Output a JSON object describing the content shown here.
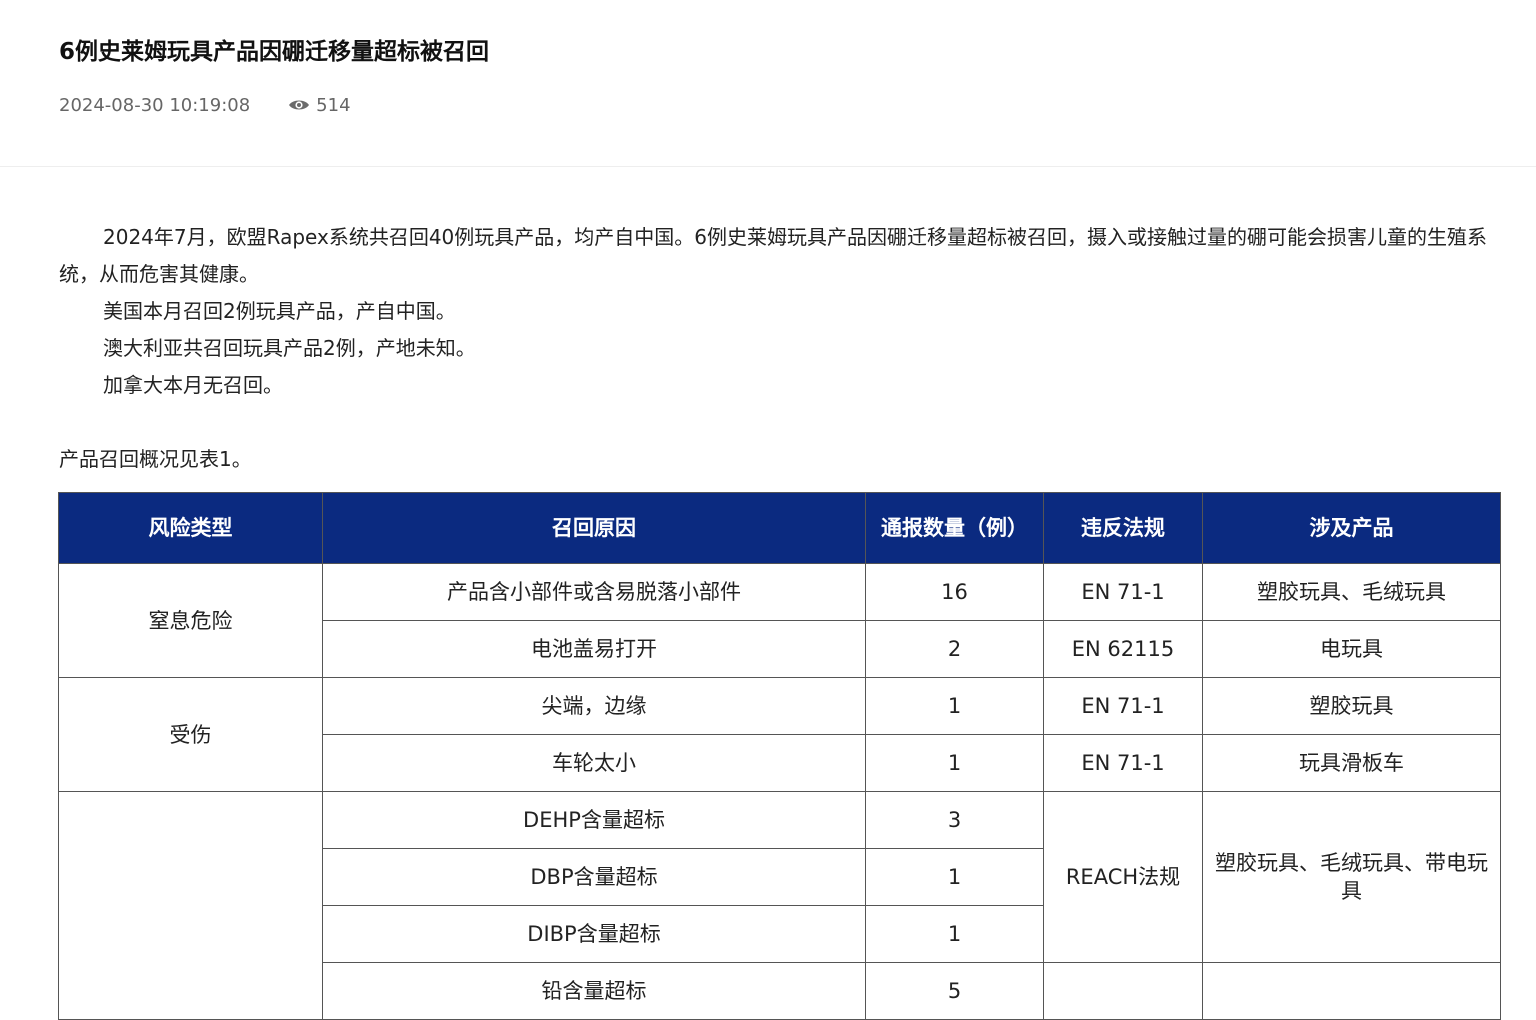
{
  "article": {
    "title": "6例史莱姆玩具产品因硼迁移量超标被召回",
    "date": "2024-08-30 10:19:08",
    "views": "514",
    "paragraphs": [
      "2024年7月，欧盟Rapex系统共召回40例玩具产品，均产自中国。6例史莱姆玩具产品因硼迁移量超标被召回，摄入或接触过量的硼可能会损害儿童的生殖系统，从而危害其健康。",
      "美国本月召回2例玩具产品，产自中国。",
      "澳大利亚共召回玩具产品2例，产地未知。",
      "加拿大本月无召回。"
    ],
    "summary": "产品召回概况见表1。"
  },
  "table": {
    "headers": [
      "风险类型",
      "召回原因",
      "通报数量（例）",
      "违反法规",
      "涉及产品"
    ],
    "groups": [
      {
        "risk": "窒息危险",
        "rows": [
          {
            "reason": "产品含小部件或含易脱落小部件",
            "count": "16",
            "regulation": "EN 71-1",
            "product": "塑胶玩具、毛绒玩具"
          },
          {
            "reason": "电池盖易打开",
            "count": "2",
            "regulation": "EN 62115",
            "product": "电玩具"
          }
        ]
      },
      {
        "risk": "受伤",
        "rows": [
          {
            "reason": "尖端，边缘",
            "count": "1",
            "regulation": "EN 71-1",
            "product": "塑胶玩具"
          },
          {
            "reason": "车轮太小",
            "count": "1",
            "regulation": "EN 71-1",
            "product": "玩具滑板车"
          }
        ]
      },
      {
        "risk": "",
        "rows": [
          {
            "reason": "DEHP含量超标",
            "count": "3"
          },
          {
            "reason": "DBP含量超标",
            "count": "1"
          },
          {
            "reason": "DIBP含量超标",
            "count": "1"
          },
          {
            "reason": "铅含量超标",
            "count": "5"
          }
        ],
        "merged_regulation": "REACH法规",
        "merged_product": "塑胶玩具、毛绒玩具、带电玩具"
      }
    ]
  },
  "colors": {
    "header_bg": "#0b2a80",
    "header_text": "#ffffff",
    "meta_text": "#666666",
    "border": "#555555"
  },
  "icons": {
    "views": "eye-icon"
  }
}
